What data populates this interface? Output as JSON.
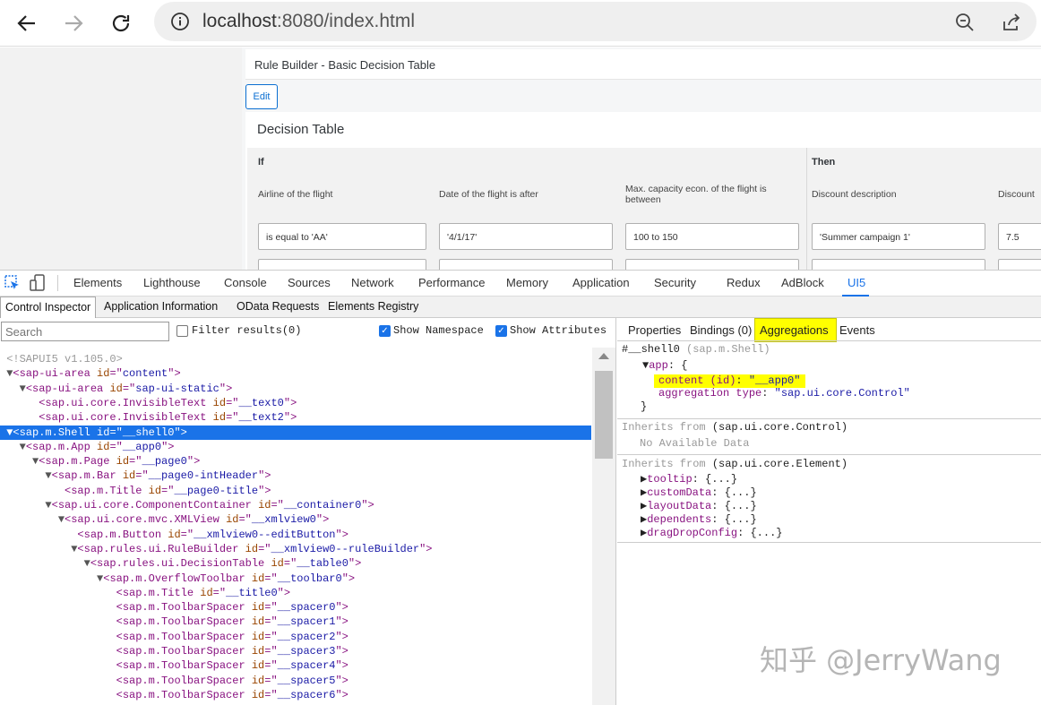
{
  "browser": {
    "url_host": "localhost",
    "url_rest": ":8080/index.html"
  },
  "app": {
    "title": "Rule Builder - Basic Decision Table",
    "edit_label": "Edit",
    "table_heading": "Decision Table",
    "group_if": "If",
    "group_then": "Then",
    "columns": [
      "Airline of the flight",
      "Date of the flight is after",
      "Max. capacity econ. of the flight is between",
      "Discount description",
      "Discount"
    ],
    "row1": [
      "is equal to 'AA'",
      "'4/1/17'",
      "100 to 150",
      "'Summer campaign 1'",
      "7.5"
    ]
  },
  "devtools": {
    "tabs": [
      "Elements",
      "Lighthouse",
      "Console",
      "Sources",
      "Network",
      "Performance",
      "Memory",
      "Application",
      "Security",
      "Redux",
      "AdBlock",
      "UI5"
    ],
    "active_tab": "UI5",
    "subtabs": [
      "Control Inspector",
      "Application Information",
      "OData Requests",
      "Elements Registry"
    ],
    "search_placeholder": "Search",
    "filter_label": "Filter results(0)",
    "show_namespace_label": "Show Namespace",
    "show_attributes_label": "Show Attributes"
  },
  "tree": [
    {
      "indent": 0,
      "tri": "",
      "text": "<!SAPUI5 v1.105.0>",
      "comment": true
    },
    {
      "indent": 0,
      "tri": "▼",
      "tag": "sap-ui-area",
      "attr": "id",
      "val": "content"
    },
    {
      "indent": 1,
      "tri": "▼",
      "tag": "sap-ui-area",
      "attr": "id",
      "val": "sap-ui-static"
    },
    {
      "indent": 2,
      "tri": "",
      "tag": "sap.ui.core.InvisibleText",
      "attr": "id",
      "val": "__text0"
    },
    {
      "indent": 2,
      "tri": "",
      "tag": "sap.ui.core.InvisibleText",
      "attr": "id",
      "val": "__text2"
    },
    {
      "indent": 0,
      "tri": "▼",
      "tag": "sap.m.Shell",
      "attr": "id",
      "val": "__shell0",
      "selected": true
    },
    {
      "indent": 1,
      "tri": "▼",
      "tag": "sap.m.App",
      "attr": "id",
      "val": "__app0"
    },
    {
      "indent": 2,
      "tri": "▼",
      "tag": "sap.m.Page",
      "attr": "id",
      "val": "__page0"
    },
    {
      "indent": 3,
      "tri": "▼",
      "tag": "sap.m.Bar",
      "attr": "id",
      "val": "__page0-intHeader"
    },
    {
      "indent": 4,
      "tri": "",
      "tag": "sap.m.Title",
      "attr": "id",
      "val": "__page0-title"
    },
    {
      "indent": 3,
      "tri": "▼",
      "tag": "sap.ui.core.ComponentContainer",
      "attr": "id",
      "val": "__container0"
    },
    {
      "indent": 4,
      "tri": "▼",
      "tag": "sap.ui.core.mvc.XMLView",
      "attr": "id",
      "val": "__xmlview0"
    },
    {
      "indent": 5,
      "tri": "",
      "tag": "sap.m.Button",
      "attr": "id",
      "val": "__xmlview0--editButton"
    },
    {
      "indent": 5,
      "tri": "▼",
      "tag": "sap.rules.ui.RuleBuilder",
      "attr": "id",
      "val": "__xmlview0--ruleBuilder"
    },
    {
      "indent": 6,
      "tri": "▼",
      "tag": "sap.rules.ui.DecisionTable",
      "attr": "id",
      "val": "__table0"
    },
    {
      "indent": 7,
      "tri": "▼",
      "tag": "sap.m.OverflowToolbar",
      "attr": "id",
      "val": "__toolbar0"
    },
    {
      "indent": 8,
      "tri": "",
      "tag": "sap.m.Title",
      "attr": "id",
      "val": "__title0"
    },
    {
      "indent": 8,
      "tri": "",
      "tag": "sap.m.ToolbarSpacer",
      "attr": "id",
      "val": "__spacer0"
    },
    {
      "indent": 8,
      "tri": "",
      "tag": "sap.m.ToolbarSpacer",
      "attr": "id",
      "val": "__spacer1"
    },
    {
      "indent": 8,
      "tri": "",
      "tag": "sap.m.ToolbarSpacer",
      "attr": "id",
      "val": "__spacer2"
    },
    {
      "indent": 8,
      "tri": "",
      "tag": "sap.m.ToolbarSpacer",
      "attr": "id",
      "val": "__spacer3"
    },
    {
      "indent": 8,
      "tri": "",
      "tag": "sap.m.ToolbarSpacer",
      "attr": "id",
      "val": "__spacer4"
    },
    {
      "indent": 8,
      "tri": "",
      "tag": "sap.m.ToolbarSpacer",
      "attr": "id",
      "val": "__spacer5"
    },
    {
      "indent": 8,
      "tri": "",
      "tag": "sap.m.ToolbarSpacer",
      "attr": "id",
      "val": "__spacer6"
    }
  ],
  "detail": {
    "tabs": [
      "Properties",
      "Bindings (0)",
      "Aggregations",
      "Events"
    ],
    "active_tab": "Aggregations",
    "control_id": "#__shell0",
    "control_type": "(sap.m.Shell)",
    "app_key": "app",
    "content_key": "content (id)",
    "content_val": "\"__app0\"",
    "agg_type_key": "aggregation type",
    "agg_type_val": "\"sap.ui.core.Control\"",
    "inherits_label": "Inherits from",
    "inherit1": "(sap.ui.core.Control)",
    "no_data": "No Available Data",
    "inherit2": "(sap.ui.core.Element)",
    "element_aggs": [
      "tooltip",
      "customData",
      "layoutData",
      "dependents",
      "dragDropConfig"
    ]
  },
  "watermark": "知乎 @JerryWang",
  "colors": {
    "accent": "#1a73e8",
    "highlight": "#ffff00",
    "sap_blue": "#0a6ed1"
  }
}
